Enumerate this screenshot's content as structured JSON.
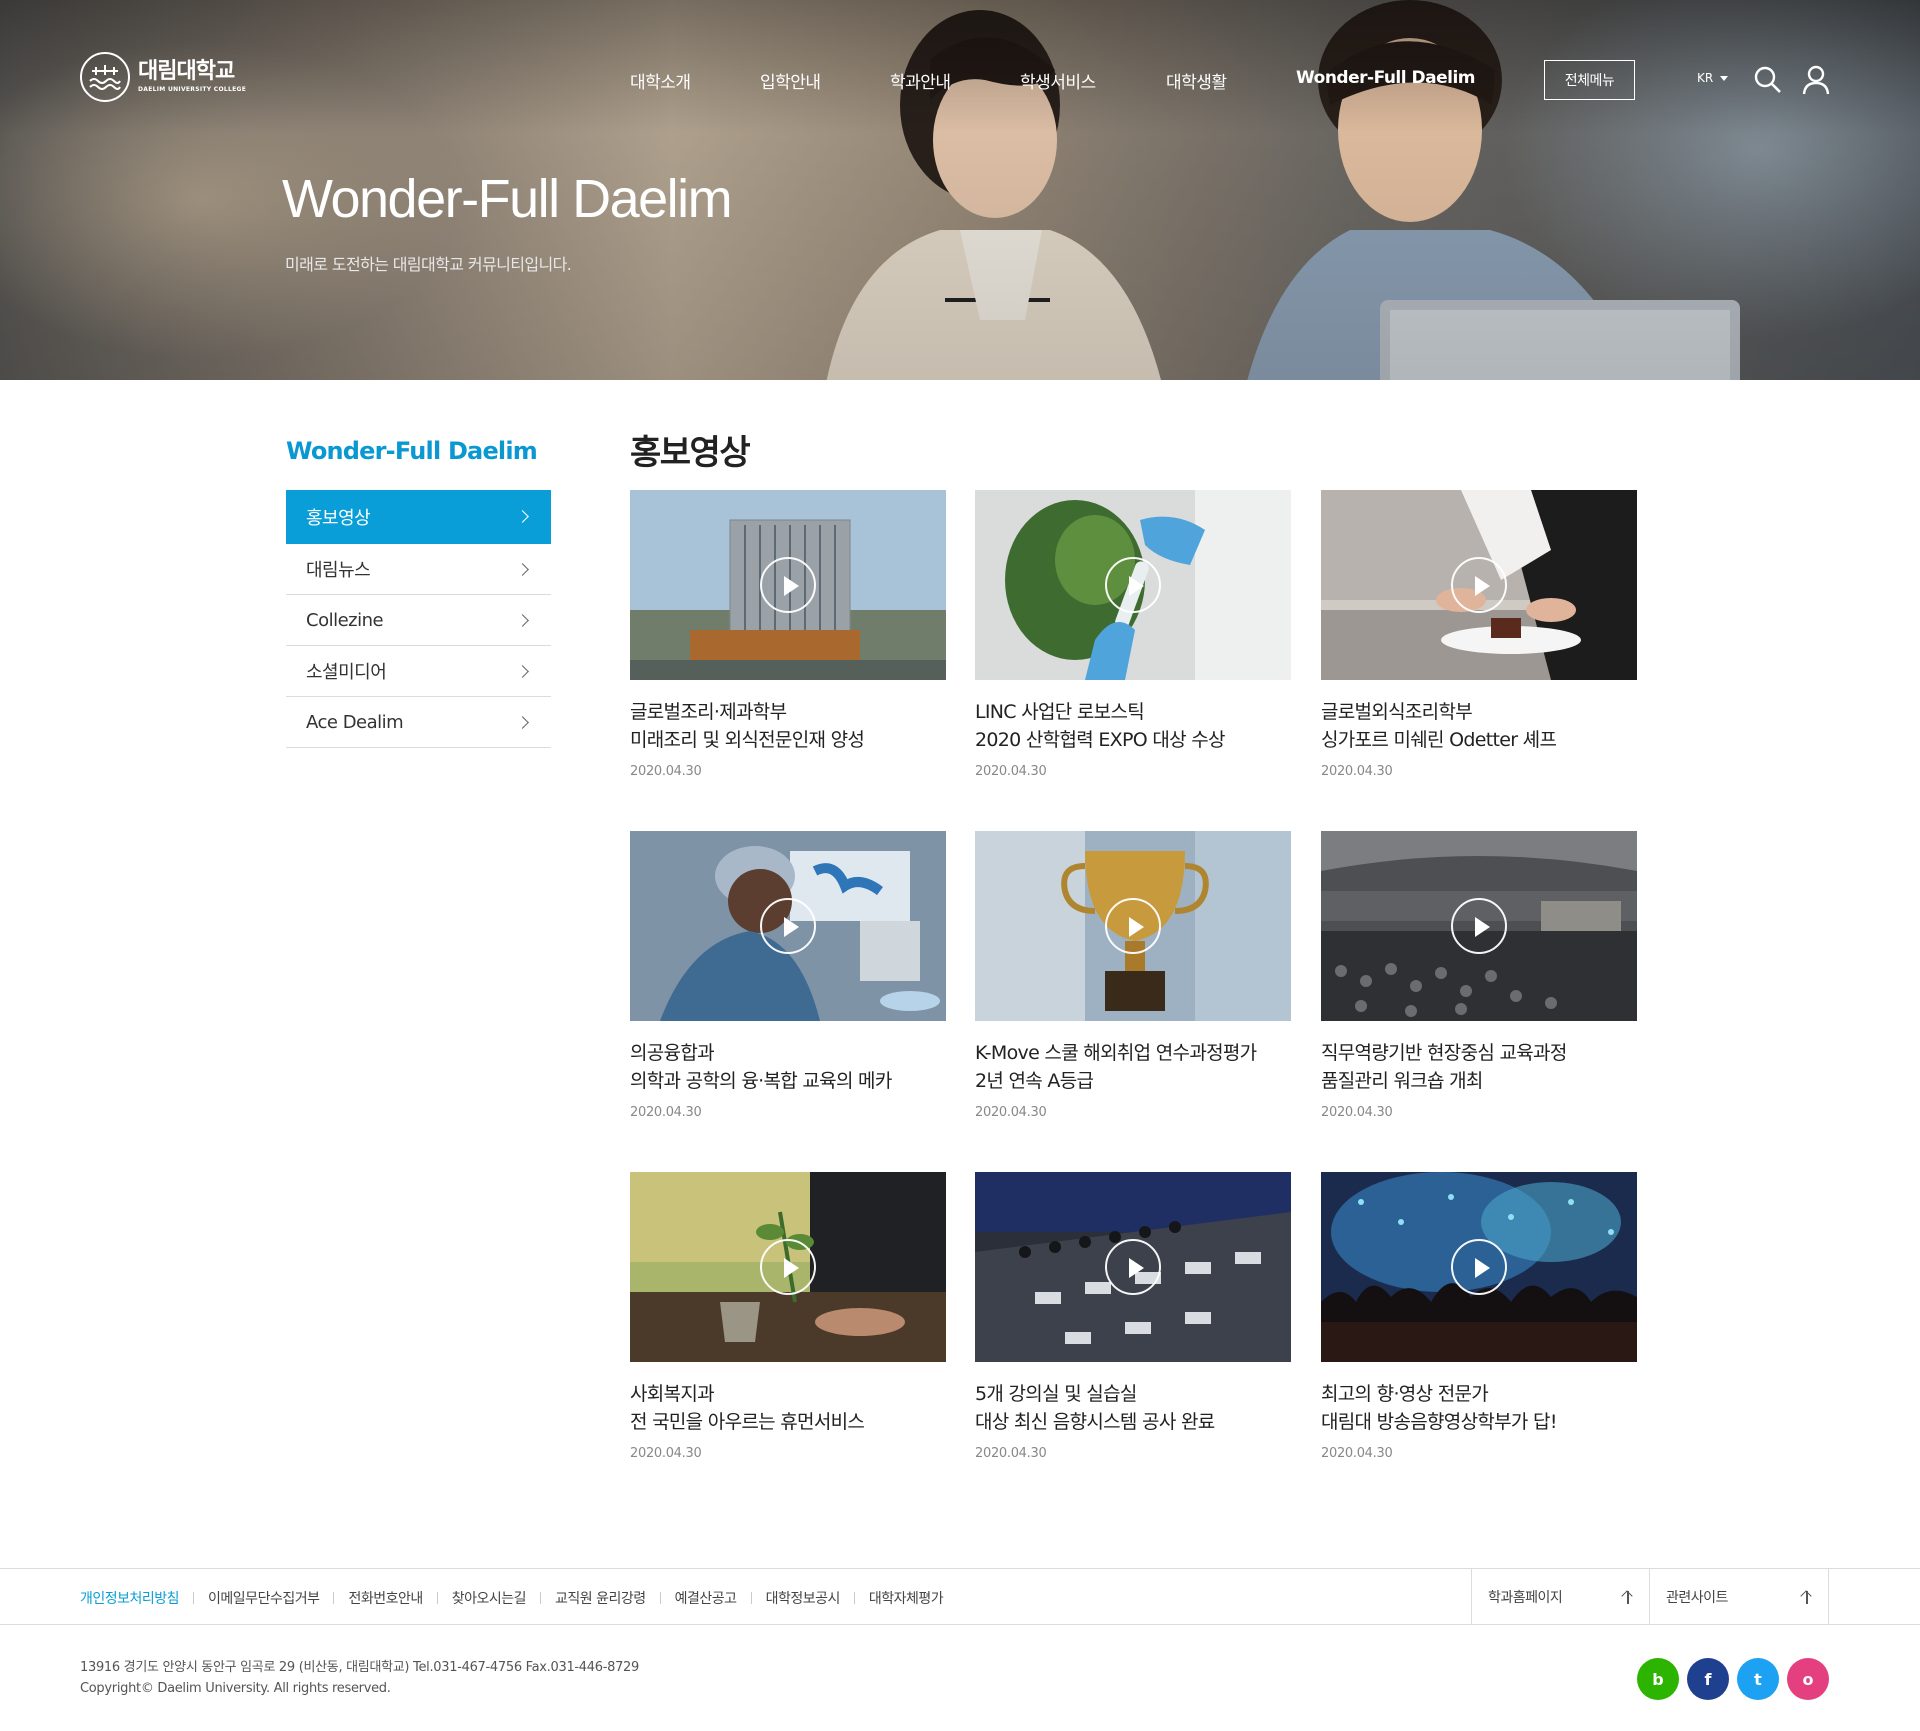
{
  "header": {
    "logo_name": "대림대학교",
    "logo_eng": "DAELIM UNIVERSITY COLLEGE",
    "nav": [
      "대학소개",
      "입학안내",
      "학과안내",
      "학생서비스",
      "대학생활",
      "Wonder-Full Daelim"
    ],
    "all_menu": "전체메뉴",
    "lang": "KR"
  },
  "hero": {
    "title": "Wonder-Full Daelim",
    "subtitle": "미래로 도전하는 대림대학교 커뮤니티입니다."
  },
  "sidebar": {
    "title": "Wonder-Full Daelim",
    "items": [
      {
        "label": "홍보영상"
      },
      {
        "label": "대림뉴스"
      },
      {
        "label": "Collezine"
      },
      {
        "label": "소셜미디어"
      },
      {
        "label": "Ace Dealim"
      }
    ]
  },
  "main": {
    "title": "홍보영상",
    "cards": [
      {
        "line1": "글로벌조리·제과학부",
        "line2": "미래조리 및 외식전문인재 양성",
        "date": "2020.04.30",
        "thumb": "building"
      },
      {
        "line1": "LINC 사업단 로보스틱",
        "line2": "2020 산학협력 EXPO 대상 수상",
        "date": "2020.04.30",
        "thumb": "lab"
      },
      {
        "line1": "글로벌외식조리학부",
        "line2": "싱가포르 미쉐린 Odetter 셰프",
        "date": "2020.04.30",
        "thumb": "chef"
      },
      {
        "line1": "의공융합과",
        "line2": "의학과 공학의 융·복합 교육의 메카",
        "date": "2020.04.30",
        "thumb": "medical"
      },
      {
        "line1": "K-Move 스쿨 해외취업 연수과정평가",
        "line2": "2년 연속 A등급",
        "date": "2020.04.30",
        "thumb": "trophy"
      },
      {
        "line1": "직무역량기반 현장중심 교육과정",
        "line2": "품질관리 워크숍 개최",
        "date": "2020.04.30",
        "thumb": "hall"
      },
      {
        "line1": "사회복지과",
        "line2": "전 국민을 아우르는 휴먼서비스",
        "date": "2020.04.30",
        "thumb": "plant"
      },
      {
        "line1": "5개 강의실 및 실습실",
        "line2": "대상 최신 음향시스템 공사 완료",
        "date": "2020.04.30",
        "thumb": "mixer"
      },
      {
        "line1": "최고의 향·영상 전문가",
        "line2": "대림대 방송음향영상학부가 답!",
        "date": "2020.04.30",
        "thumb": "concert"
      }
    ]
  },
  "footer": {
    "links": [
      "개인정보처리방침",
      "이메일무단수집거부",
      "전화번호안내",
      "찾아오시는길",
      "교직원 윤리강령",
      "예결산공고",
      "대학정보공시",
      "대학자체평가"
    ],
    "select1": "학과홈페이지",
    "select2": "관련사이트",
    "address": "13916 경기도 안양시 동안구 임곡로 29 (비산동, 대림대학교)  Tel.031-467-4756   Fax.031-446-8729",
    "copyright": "Copyright© Daelim University. All rights reserved.",
    "sns": [
      {
        "icon": "blog-icon",
        "glyph": "b",
        "color": "#2db400"
      },
      {
        "icon": "facebook-icon",
        "glyph": "f",
        "color": "#1f3f8f"
      },
      {
        "icon": "twitter-icon",
        "glyph": "t",
        "color": "#1da1f2"
      },
      {
        "icon": "instagram-icon",
        "glyph": "o",
        "color": "#e4407f"
      }
    ]
  },
  "colors": {
    "accent": "#0a9ed9"
  }
}
